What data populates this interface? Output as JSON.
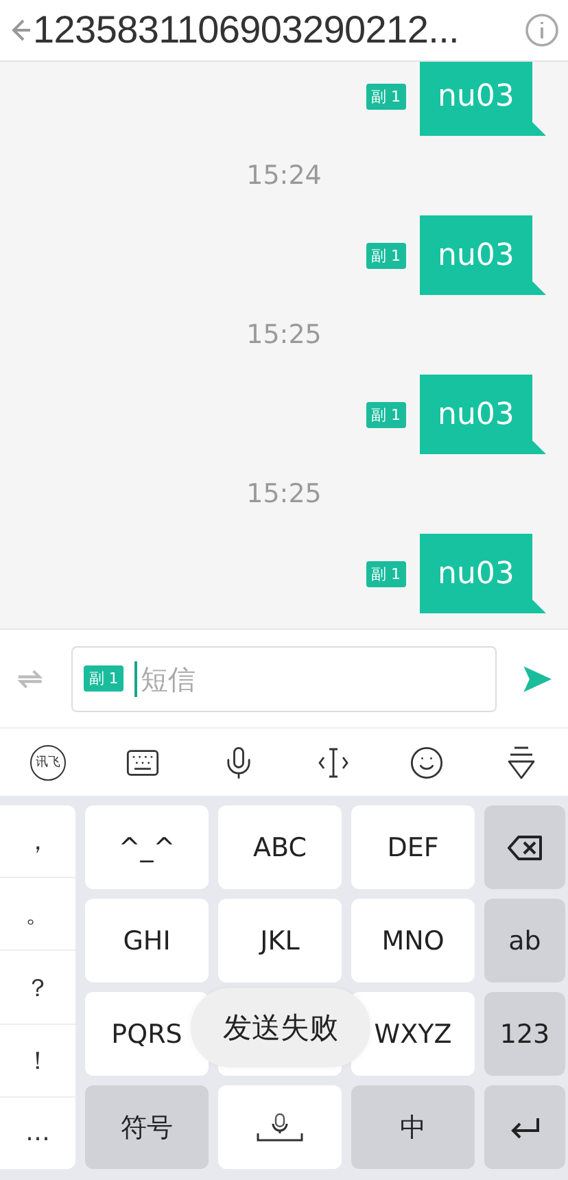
{
  "header": {
    "title": "1235831106903290212..."
  },
  "messages": [
    {
      "kind": "bubble",
      "tag": "副 1",
      "text": "nu03"
    },
    {
      "kind": "time",
      "text": "15:24"
    },
    {
      "kind": "bubble",
      "tag": "副 1",
      "text": "nu03"
    },
    {
      "kind": "time",
      "text": "15:25"
    },
    {
      "kind": "bubble",
      "tag": "副 1",
      "text": "nu03"
    },
    {
      "kind": "time",
      "text": "15:25"
    },
    {
      "kind": "bubble",
      "tag": "副 1",
      "text": "nu03"
    }
  ],
  "composer": {
    "tag": "副 1",
    "placeholder": "短信"
  },
  "toolbar": {
    "logo": "讯飞"
  },
  "keyboard": {
    "punctuation": [
      "，",
      "。",
      "？",
      "！",
      "…"
    ],
    "keys": [
      {
        "kind": "text",
        "function_key": false,
        "label": "^_^"
      },
      {
        "kind": "text",
        "function_key": false,
        "label": "ABC"
      },
      {
        "kind": "text",
        "function_key": false,
        "label": "DEF"
      },
      {
        "kind": "backspace",
        "function_key": true
      },
      {
        "kind": "text",
        "function_key": false,
        "label": "GHI"
      },
      {
        "kind": "text",
        "function_key": false,
        "label": "JKL"
      },
      {
        "kind": "text",
        "function_key": false,
        "label": "MNO"
      },
      {
        "kind": "text",
        "function_key": true,
        "label": "ab"
      },
      {
        "kind": "text",
        "function_key": false,
        "label": "PQRS"
      },
      {
        "kind": "blank",
        "function_key": false
      },
      {
        "kind": "text",
        "function_key": false,
        "label": "WXYZ"
      },
      {
        "kind": "text",
        "function_key": true,
        "label": "123"
      },
      {
        "kind": "text",
        "function_key": true,
        "label": "符号"
      },
      {
        "kind": "space",
        "function_key": false
      },
      {
        "kind": "text",
        "function_key": true,
        "label": "中"
      },
      {
        "kind": "enter",
        "function_key": true
      }
    ]
  },
  "toast": {
    "text": "发送失败"
  }
}
